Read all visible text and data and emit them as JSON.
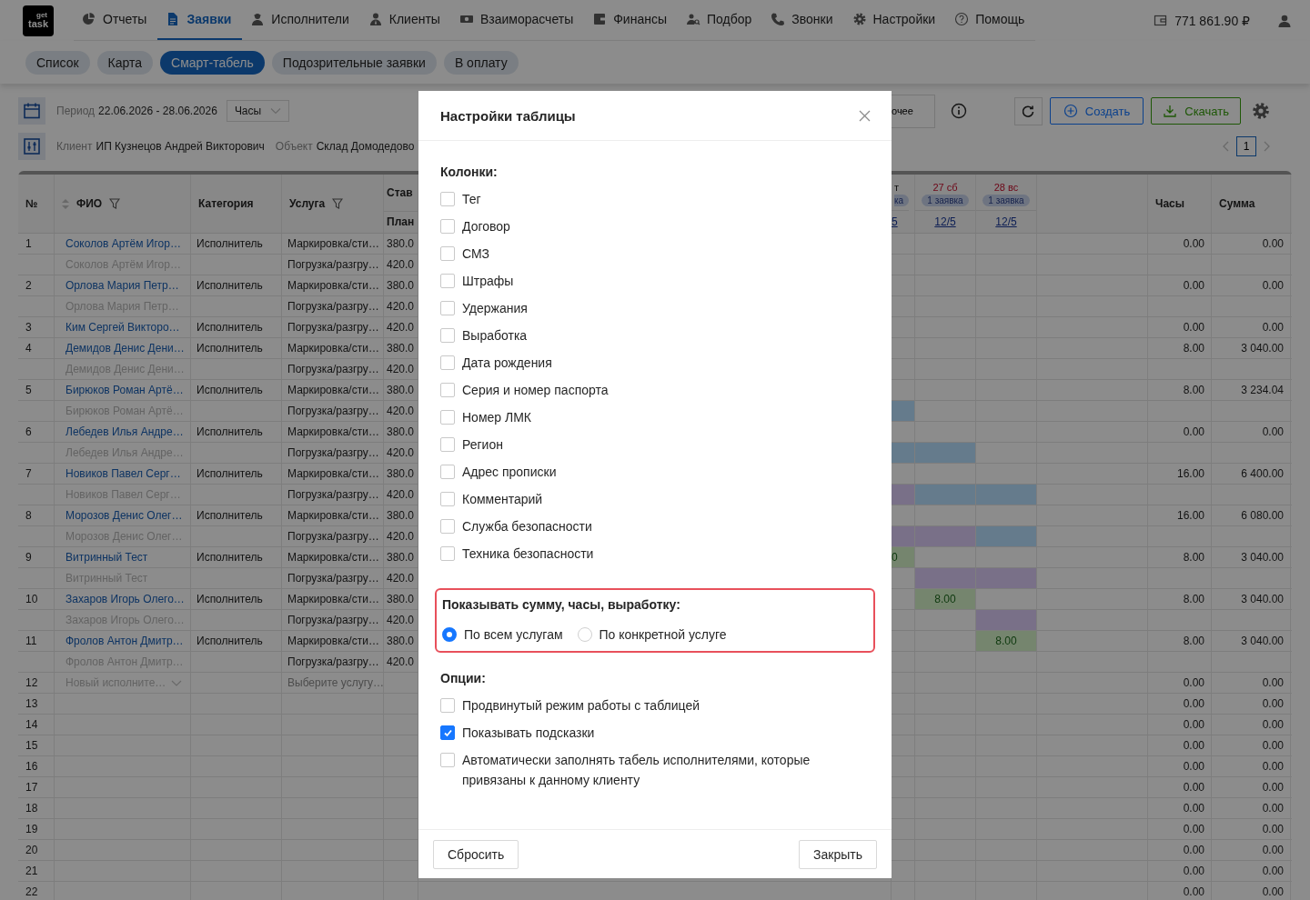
{
  "nav": {
    "logo": {
      "top": "get",
      "bottom": "task"
    },
    "items": [
      {
        "label": "Отчеты",
        "selected": false
      },
      {
        "label": "Заявки",
        "selected": true
      },
      {
        "label": "Исполнители",
        "selected": false
      },
      {
        "label": "Клиенты",
        "selected": false
      },
      {
        "label": "Взаиморасчеты",
        "selected": false
      },
      {
        "label": "Финансы",
        "selected": false
      },
      {
        "label": "Подбор",
        "selected": false
      },
      {
        "label": "Звонки",
        "selected": false
      },
      {
        "label": "Настройки",
        "selected": false
      },
      {
        "label": "Помощь",
        "selected": false
      }
    ],
    "balance": "771 861.90 ₽"
  },
  "subtabs": [
    {
      "label": "Список",
      "selected": false
    },
    {
      "label": "Карта",
      "selected": false
    },
    {
      "label": "Смарт-табель",
      "selected": true
    },
    {
      "label": "Подозрительные заявки",
      "selected": false
    },
    {
      "label": "В оплату",
      "selected": false
    }
  ],
  "toolbar": {
    "period_label": "Период",
    "period": "22.06.2026 - 28.06.2026",
    "unit": "Часы",
    "client_label": "Клиент",
    "client": "ИП Кузнецов Андрей Викторович",
    "object_label": "Объект",
    "object": "Склад Домодедово",
    "other_button": "очее",
    "create_button": "Создать",
    "download_button": "Скачать",
    "page": "1"
  },
  "table": {
    "columns": {
      "num": "№",
      "name": "ФИО",
      "category": "Категория",
      "service": "Услуга",
      "rate": "Став",
      "rate_sub": "План",
      "hours": "Часы",
      "sum": "Сумма"
    },
    "day_columns": [
      {
        "day": "т",
        "requests": "ка",
        "link": "5",
        "weekend": false
      },
      {
        "day": "27 сб",
        "requests": "1 заявка",
        "link": "12/5",
        "weekend": true
      },
      {
        "day": "28 вс",
        "requests": "1 заявка",
        "link": "12/5",
        "weekend": true
      }
    ],
    "rows": [
      {
        "kind": "main",
        "num": "1",
        "name": "Соколов Артём Игор…",
        "category": "Исполнитель",
        "service": "Маркировка/сти…",
        "rate": "380.0",
        "hours": "0.00",
        "sum": "0.00"
      },
      {
        "kind": "sub",
        "name": "Соколов Артём Игор…",
        "service": "Погрузка/разгру…",
        "rate": "420.0"
      },
      {
        "kind": "main",
        "num": "2",
        "name": "Орлова Мария Петр…",
        "category": "Исполнитель",
        "service": "Маркировка/сти…",
        "rate": "380.0",
        "hours": "0.00",
        "sum": "0.00"
      },
      {
        "kind": "sub",
        "name": "Орлова Мария Петр…",
        "service": "Погрузка/разгру…",
        "rate": "420.0"
      },
      {
        "kind": "main",
        "num": "3",
        "name": "Ким Сергей Викторо…",
        "category": "Исполнитель",
        "service": "Погрузка/разгру…",
        "rate": "420.0",
        "hours": "0.00",
        "sum": "0.00"
      },
      {
        "kind": "main",
        "num": "4",
        "name": "Демидов Денис Дени…",
        "category": "Исполнитель",
        "service": "Маркировка/сти…",
        "rate": "380.0",
        "hours": "8.00",
        "sum": "3 040.00"
      },
      {
        "kind": "sub",
        "name": "Демидов Денис Дени…",
        "service": "Погрузка/разгру…",
        "rate": "420.0"
      },
      {
        "kind": "main",
        "num": "5",
        "name": "Бирюков Роман Артё…",
        "category": "Исполнитель",
        "service": "Маркировка/сти…",
        "rate": "380.0",
        "hours": "8.00",
        "sum": "3 234.04"
      },
      {
        "kind": "sub",
        "name": "Бирюков Роман Артё…",
        "service": "Погрузка/разгру…",
        "rate": "420.0",
        "cells": [
          {
            "kind": "fill",
            "color": "#667b8c"
          },
          {
            "kind": "plain"
          },
          {
            "kind": "plain"
          }
        ]
      },
      {
        "kind": "main",
        "num": "6",
        "name": "Лебедев Илья Андре…",
        "category": "Исполнитель",
        "service": "Маркировка/сти…",
        "rate": "380.0",
        "hours": "0.00",
        "sum": "0.00"
      },
      {
        "kind": "sub",
        "name": "Лебедев Илья Андре…",
        "service": "Погрузка/разгру…",
        "rate": "420.0",
        "cells": [
          {
            "kind": "fill",
            "color": "#667b8c"
          },
          {
            "kind": "fill",
            "color": "#667b8c"
          },
          {
            "kind": "plain"
          }
        ]
      },
      {
        "kind": "main",
        "num": "7",
        "name": "Новиков Павел Серг…",
        "category": "Исполнитель",
        "service": "Маркировка/сти…",
        "rate": "380.0",
        "hours": "16.00",
        "sum": "6 400.00"
      },
      {
        "kind": "sub",
        "name": "Новиков Павел Серг…",
        "service": "Погрузка/разгру…",
        "rate": "420.0",
        "cells": [
          {
            "kind": "fill",
            "color": "#797088"
          },
          {
            "kind": "fill",
            "color": "#667b8c"
          },
          {
            "kind": "fill",
            "color": "#667b8c"
          }
        ]
      },
      {
        "kind": "main",
        "num": "8",
        "name": "Морозов Денис Олег…",
        "category": "Исполнитель",
        "service": "Маркировка/сти…",
        "rate": "380.0",
        "hours": "16.00",
        "sum": "6 080.00"
      },
      {
        "kind": "sub",
        "name": "Морозов Денис Олег…",
        "service": "Погрузка/разгру…",
        "rate": "420.0",
        "cells": [
          {
            "kind": "fill",
            "color": "#797088"
          },
          {
            "kind": "fill",
            "color": "#797088"
          },
          {
            "kind": "fill",
            "color": "#667b8c"
          }
        ]
      },
      {
        "kind": "main",
        "num": "9",
        "name": "Витринный Тест",
        "category": "Исполнитель",
        "service": "Маркировка/сти…",
        "rate": "380.0",
        "hours": "8.00",
        "sum": "3 040.00",
        "cells": [
          {
            "kind": "fill",
            "color": "#75856e",
            "text": "0"
          },
          {
            "kind": "plain"
          },
          {
            "kind": "plain"
          }
        ]
      },
      {
        "kind": "sub",
        "name": "Витринный Тест",
        "service": "Погрузка/разгру…",
        "rate": "420.0",
        "cells": [
          {
            "kind": "plain"
          },
          {
            "kind": "fill",
            "color": "#797088"
          },
          {
            "kind": "fill",
            "color": "#797088"
          }
        ]
      },
      {
        "kind": "main",
        "num": "10",
        "name": "Захаров Игорь Олего…",
        "category": "Исполнитель",
        "service": "Маркировка/сти…",
        "rate": "380.0",
        "hours": "8.00",
        "sum": "3 040.00",
        "cells": [
          {
            "kind": "plain"
          },
          {
            "kind": "fill",
            "color": "#75856e",
            "text": "8.00"
          },
          {
            "kind": "plain"
          }
        ]
      },
      {
        "kind": "sub",
        "name": "Захаров Игорь Олего…",
        "service": "Погрузка/разгру…",
        "rate": "420.0",
        "cells": [
          {
            "kind": "plain"
          },
          {
            "kind": "plain"
          },
          {
            "kind": "fill",
            "color": "#797088"
          }
        ]
      },
      {
        "kind": "main",
        "num": "11",
        "name": "Фролов Антон Дмитр…",
        "category": "Исполнитель",
        "service": "Маркировка/сти…",
        "rate": "380.0",
        "hours": "8.00",
        "sum": "3 040.00",
        "cells": [
          {
            "kind": "plain"
          },
          {
            "kind": "plain"
          },
          {
            "kind": "fill",
            "color": "#75856e",
            "text": "8.00"
          }
        ]
      },
      {
        "kind": "sub",
        "name": "Фролов Антон Дмитр…",
        "service": "Погрузка/разгру…",
        "rate": "420.0"
      },
      {
        "kind": "new",
        "num": "12",
        "name": "Новый исполните…",
        "service": "Выберите услугу…",
        "hours": "0.00",
        "sum": "0.00"
      },
      {
        "kind": "empty",
        "num": "13",
        "hours": "0.00",
        "sum": "0.00"
      },
      {
        "kind": "empty",
        "num": "14",
        "hours": "0.00",
        "sum": "0.00"
      },
      {
        "kind": "empty",
        "num": "15",
        "hours": "0.00",
        "sum": "0.00"
      },
      {
        "kind": "empty",
        "num": "16",
        "hours": "0.00",
        "sum": "0.00"
      },
      {
        "kind": "empty",
        "num": "17",
        "hours": "0.00",
        "sum": "0.00"
      },
      {
        "kind": "empty",
        "num": "18",
        "hours": "0.00",
        "sum": "0.00"
      },
      {
        "kind": "empty",
        "num": "19",
        "hours": "0.00",
        "sum": "0.00"
      },
      {
        "kind": "empty",
        "num": "20",
        "hours": "0.00",
        "sum": "0.00"
      },
      {
        "kind": "empty",
        "num": "21",
        "hours": "0.00",
        "sum": "0.00"
      },
      {
        "kind": "empty",
        "num": "22",
        "hours": "0.00",
        "sum": "0.00"
      }
    ]
  },
  "modal": {
    "title": "Настройки таблицы",
    "columns_title": "Колонки:",
    "columns": [
      {
        "label": "Тег",
        "checked": false
      },
      {
        "label": "Договор",
        "checked": false
      },
      {
        "label": "СМЗ",
        "checked": false
      },
      {
        "label": "Штрафы",
        "checked": false
      },
      {
        "label": "Удержания",
        "checked": false
      },
      {
        "label": "Выработка",
        "checked": false
      },
      {
        "label": "Дата рождения",
        "checked": false
      },
      {
        "label": "Серия и номер паспорта",
        "checked": false
      },
      {
        "label": "Номер ЛМК",
        "checked": false
      },
      {
        "label": "Регион",
        "checked": false
      },
      {
        "label": "Адрес прописки",
        "checked": false
      },
      {
        "label": "Комментарий",
        "checked": false
      },
      {
        "label": "Служба безопасности",
        "checked": false
      },
      {
        "label": "Техника безопасности",
        "checked": false
      }
    ],
    "totals_title": "Показывать сумму, часы, выработку:",
    "totals_highlighted": true,
    "totals_options": [
      {
        "label": "По всем услугам",
        "selected": true
      },
      {
        "label": "По конкретной услуге",
        "selected": false
      }
    ],
    "options_title": "Опции:",
    "options": [
      {
        "label": "Продвинутый режим работы с таблицей",
        "checked": false
      },
      {
        "label": "Показывать подсказки",
        "checked": true
      },
      {
        "label": "Автоматически заполнять табель исполнителями, которые привязаны к данному клиенту",
        "checked": false
      }
    ],
    "reset_button": "Сбросить",
    "close_button": "Закрыть"
  }
}
